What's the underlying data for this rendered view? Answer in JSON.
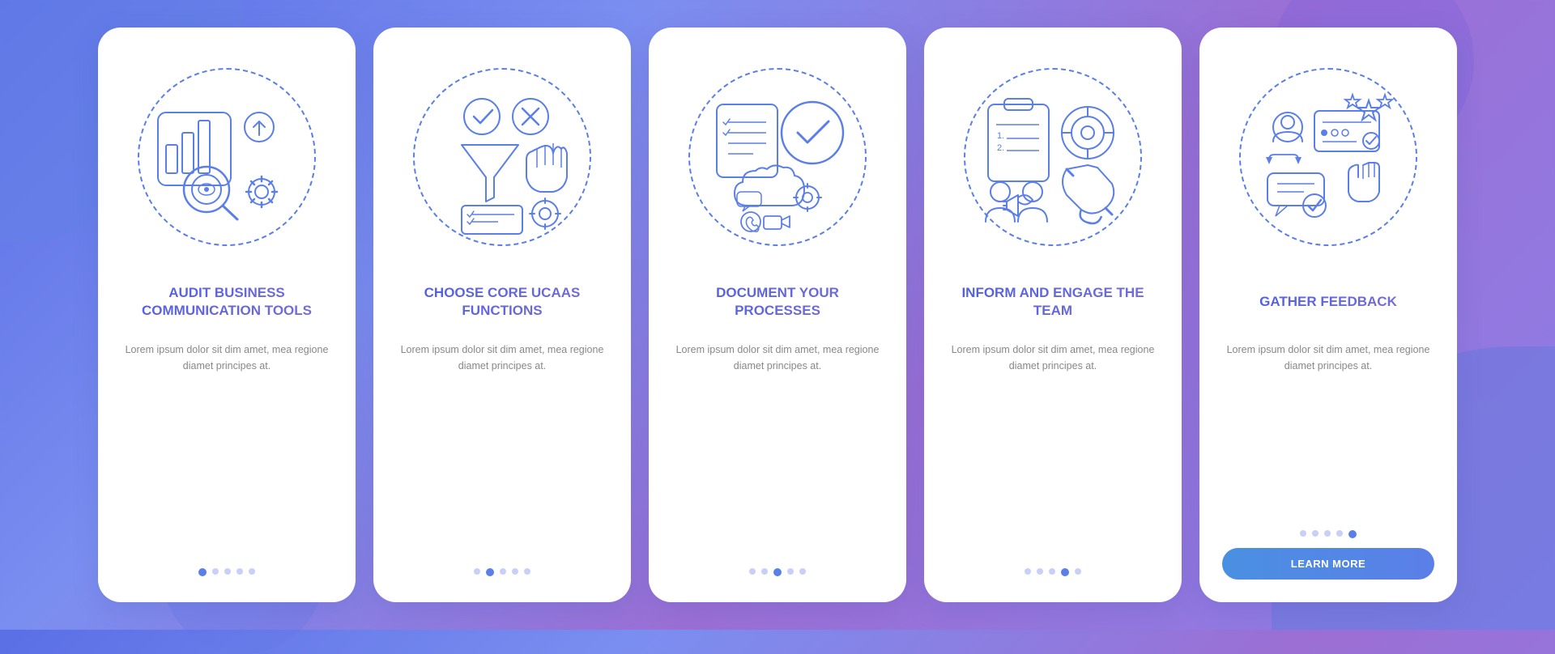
{
  "background": {
    "gradient_start": "#5b6fe6",
    "gradient_end": "#9b6fd4"
  },
  "cards": [
    {
      "id": "card-1",
      "title": "AUDIT BUSINESS COMMUNICATION TOOLS",
      "description": "Lorem ipsum dolor sit dim amet, mea regione diamet principes at.",
      "active_dot": 1,
      "dots": 5,
      "has_button": false
    },
    {
      "id": "card-2",
      "title": "CHOOSE CORE UCAAS FUNCTIONS",
      "description": "Lorem ipsum dolor sit dim amet, mea regione diamet principes at.",
      "active_dot": 2,
      "dots": 5,
      "has_button": false
    },
    {
      "id": "card-3",
      "title": "DOCUMENT YOUR PROCESSES",
      "description": "Lorem ipsum dolor sit dim amet, mea regione diamet principes at.",
      "active_dot": 3,
      "dots": 5,
      "has_button": false
    },
    {
      "id": "card-4",
      "title": "INFORM AND ENGAGE THE TEAM",
      "description": "Lorem ipsum dolor sit dim amet, mea regione diamet principes at.",
      "active_dot": 4,
      "dots": 5,
      "has_button": false
    },
    {
      "id": "card-5",
      "title": "GATHER FEEDBACK",
      "description": "Lorem ipsum dolor sit dim amet, mea regione diamet principes at.",
      "active_dot": 5,
      "dots": 5,
      "has_button": true,
      "button_label": "LEARN MORE"
    }
  ]
}
